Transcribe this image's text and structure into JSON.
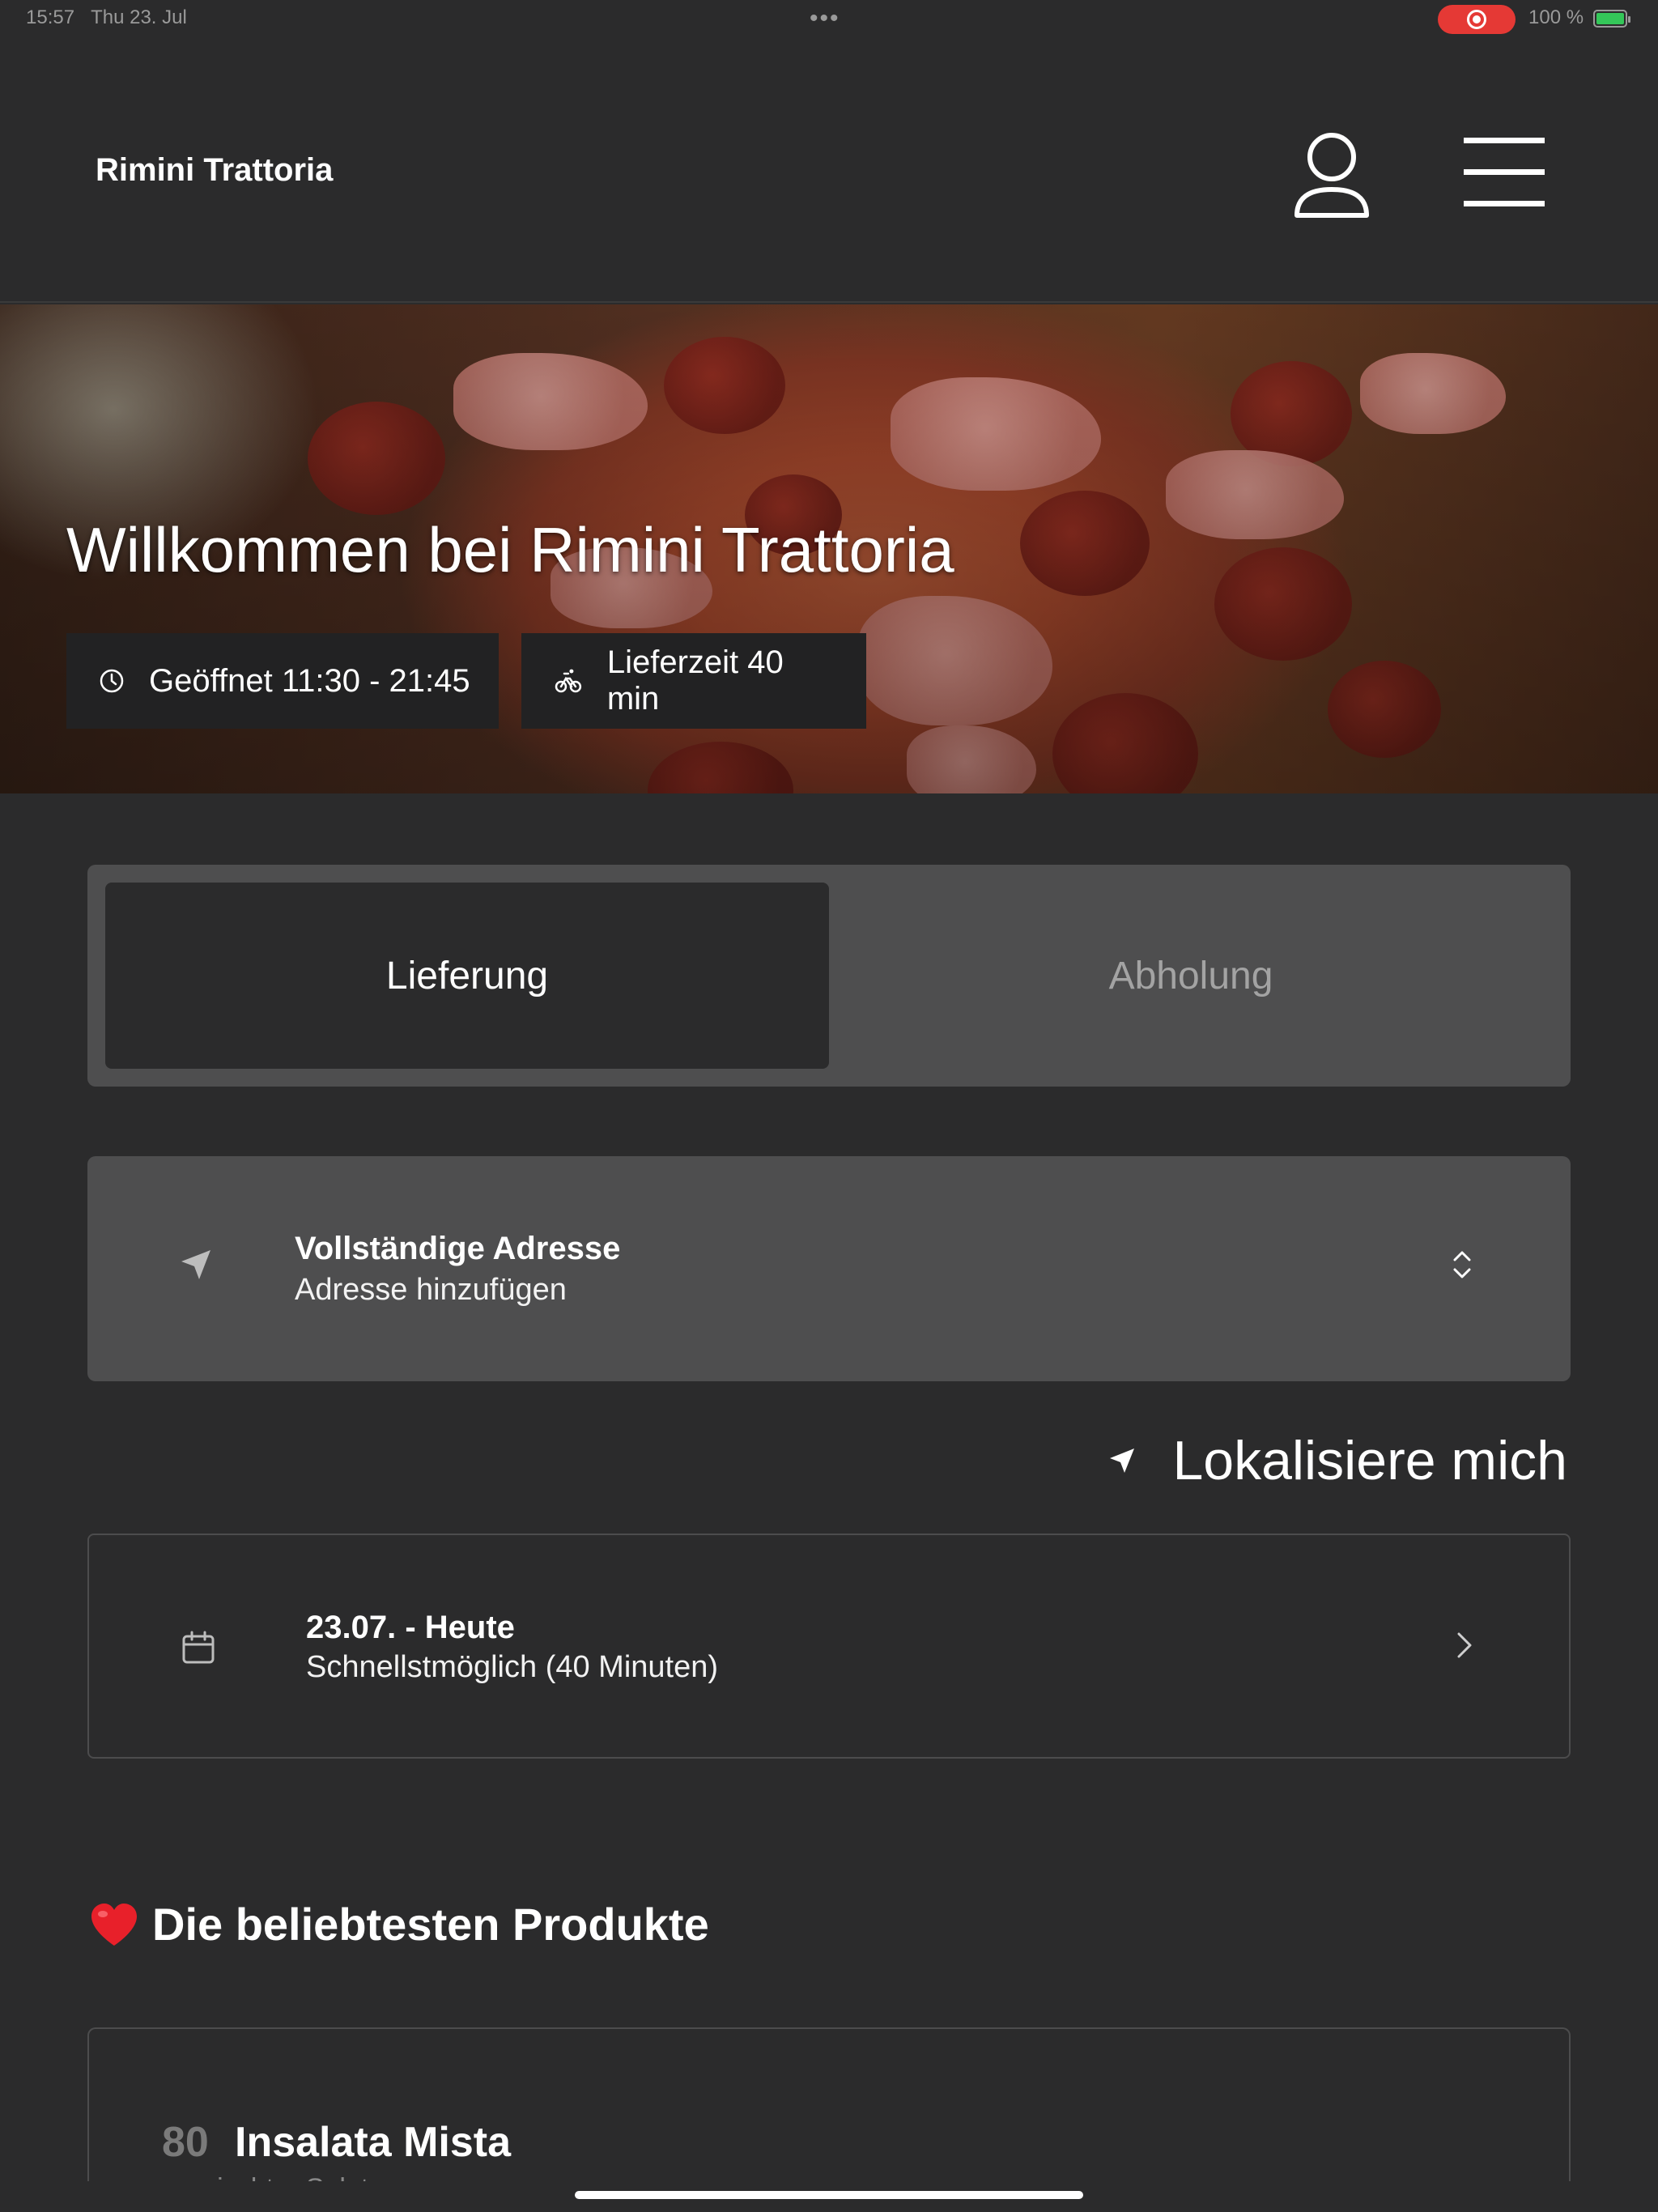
{
  "status_bar": {
    "time": "15:57",
    "date": "Thu 23. Jul",
    "multitask_dots": "•••",
    "battery_percent": "100 %",
    "battery_level": 1.0,
    "colors": {
      "recording": "#e53935",
      "battery": "#34c759"
    }
  },
  "header": {
    "brand": "Rimini Trattoria",
    "icons": [
      "user-icon",
      "hamburger-menu-icon"
    ]
  },
  "hero": {
    "title": "Willkommen bei Rimini Trattoria",
    "opening_hours": "Geöffnet 11:30 - 21:45",
    "delivery_time": "Lieferzeit 40 min",
    "icons": [
      "clock-icon",
      "bicycle-icon"
    ]
  },
  "order_mode": {
    "tabs": [
      {
        "label": "Lieferung",
        "selected": true
      },
      {
        "label": "Abholung",
        "selected": false
      }
    ]
  },
  "address": {
    "label": "Vollständige Adresse",
    "value": "Adresse hinzufügen",
    "icons": [
      "navigation-arrow-icon",
      "chevron-up-down-icon"
    ]
  },
  "locate": {
    "label": "Lokalisiere mich",
    "icon": "location-arrow-icon"
  },
  "delivery_date": {
    "date": "23.07. - Heute",
    "time": "Schnellstmöglich (40 Minuten)",
    "icons": [
      "calendar-icon",
      "chevron-right-icon"
    ]
  },
  "popular": {
    "heading": "Die beliebtesten Produkte",
    "icon": "heart-icon",
    "products": [
      {
        "number": "80",
        "name": "Insalata Mista",
        "description": "gemischter Salat"
      }
    ]
  },
  "theme": {
    "background": "#2b2b2c",
    "panel": "#4e4e4f",
    "badge": "#222223"
  }
}
